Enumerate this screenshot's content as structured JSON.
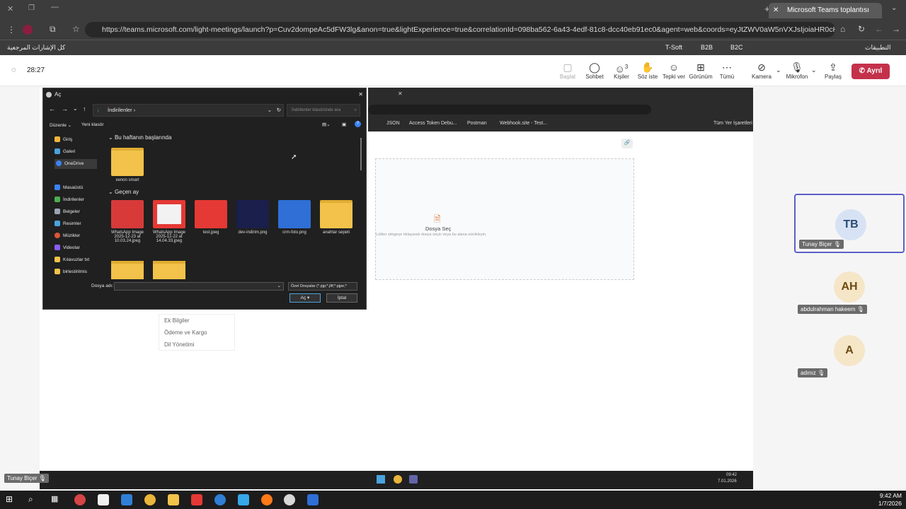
{
  "browser": {
    "tab_title": "Microsoft Teams toplantısı",
    "url": "https://teams.microsoft.com/light-meetings/launch?p=Cuv2dompeAc5dFW3lg&anon=true&lightExperience=true&correlationId=098ba562-6a43-4edf-81c8-dcc40eb91ec0&agent=web&coords=eyJtZWV0aW5nVXJsIjoiaHR0cHM6Ly90ZWFtcy5...",
    "bookmarks_left": "كل الإشارات المرجعية",
    "bookmarks_right": [
      "T-Soft",
      "B2B",
      "B2C",
      "التطبيقات"
    ]
  },
  "meeting": {
    "timer": "28:27",
    "toolbar": [
      {
        "label": "Başlat",
        "icon": "start-icon"
      },
      {
        "label": "Sohbet",
        "icon": "chat-icon"
      },
      {
        "label": "Kişiler",
        "icon": "people-icon",
        "badge": "3"
      },
      {
        "label": "Söz iste",
        "icon": "raise-hand-icon"
      },
      {
        "label": "Tepki ver",
        "icon": "react-icon"
      },
      {
        "label": "Görünüm",
        "icon": "view-icon"
      },
      {
        "label": "Tümü",
        "icon": "more-icon"
      },
      {
        "label": "Kamera",
        "icon": "camera-off-icon"
      },
      {
        "label": "Mikrofon",
        "icon": "mic-off-icon"
      },
      {
        "label": "Paylaş",
        "icon": "share-icon"
      }
    ],
    "leave_label": "Ayrıl",
    "participants": [
      {
        "initials": "TB",
        "name": "Tunay Biçer"
      },
      {
        "initials": "AH",
        "name": "abdulrahman hakeem"
      },
      {
        "initials": "A",
        "name": "adınız"
      }
    ],
    "sharer_name": "Tunay Biçer"
  },
  "shared_screen": {
    "bookmarks": [
      "JSON",
      "Access Token Debu...",
      "Postman",
      "Webhook.site - Test...",
      "Tüm Yer İşaretleri"
    ],
    "dropzone_title": "Dosya Seç",
    "dropzone_hint": "Lütfen simgeye tıklayarak dosya seçin veya bu alana sürükleyin.",
    "menu": [
      "Ek Bilgiler",
      "Ödeme ve Kargo",
      "Dil Yönetimi"
    ],
    "clock_time": "09:42",
    "clock_date": "7.01.2026"
  },
  "file_dialog": {
    "title": "Aç",
    "path": "İndirilenler",
    "search_placeholder": "İndirilenler klasöründe ara",
    "cmd_organize": "Düzenle",
    "cmd_new_folder": "Yeni klasör",
    "sidebar": [
      "Giriş",
      "Galeri",
      "OneDrive",
      "Masaüstü",
      "İndirilenler",
      "Belgeler",
      "Resimler",
      "Müzikler",
      "Videolar",
      "Kılavuzlar txt",
      "birlestirilmis"
    ],
    "group_this_week": "Bu haftanın başlarında",
    "group_last_month": "Geçen ay",
    "files_this_week": [
      "xenon smart"
    ],
    "files_last_month": [
      "WhatsApp Image 2025-12-23 at 10.03.24.jpeg",
      "WhatsApp Image 2025-12-22 at 14.04.33.jpeg",
      "test.jpeg",
      "dev-indirim.png",
      "crm-foto.png",
      "anahtar sepeti"
    ],
    "filename_label": "Dosya adı:",
    "filetype": "Özel Dosyalar (*.pjp;*.jfif;*.pjpe;*",
    "open_label": "Aç",
    "cancel_label": "İptal"
  },
  "taskbar": {
    "time": "9:42 AM",
    "date": "1/7/2026"
  }
}
